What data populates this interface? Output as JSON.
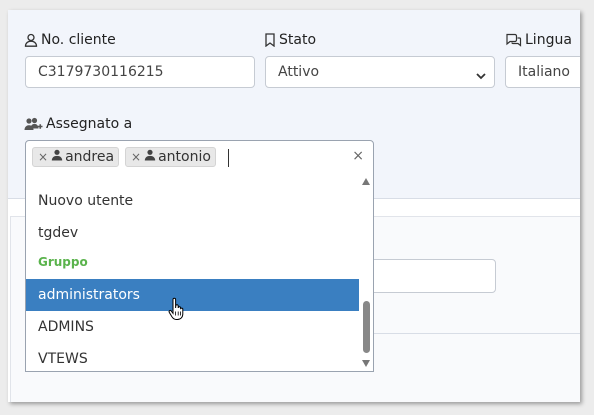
{
  "form": {
    "client_no": {
      "label": "No. cliente",
      "value": "C3179730116215"
    },
    "status": {
      "label": "Stato",
      "value": "Attivo"
    },
    "language": {
      "label": "Lingua",
      "value": "Italiano"
    },
    "assigned": {
      "label": "Assegnato a",
      "tags": [
        {
          "label": "andrea",
          "remove": "×"
        },
        {
          "label": "antonio",
          "remove": "×"
        }
      ],
      "clear": "×",
      "options": [
        {
          "label": "Nuovo utente",
          "kind": "option"
        },
        {
          "label": "tgdev",
          "kind": "option"
        },
        {
          "label": "Gruppo",
          "kind": "group"
        },
        {
          "label": "administrators",
          "kind": "option",
          "highlighted": true
        },
        {
          "label": "ADMINS",
          "kind": "option"
        },
        {
          "label": "VTEWS",
          "kind": "option"
        }
      ]
    }
  },
  "colors": {
    "highlight": "#3a7fc1",
    "group_label": "#5ab34c",
    "panel_bg": "#f2f5fb"
  },
  "icons": [
    "user-icon",
    "bookmark-icon",
    "chat-icon",
    "users-add-icon",
    "hand-cursor-icon"
  ]
}
